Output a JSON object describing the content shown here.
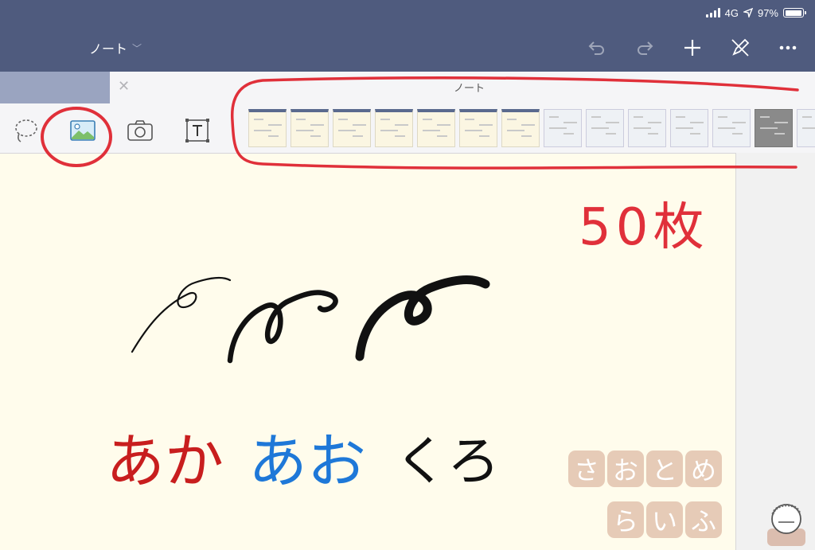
{
  "status": {
    "network": "4G",
    "battery_text": "97%",
    "battery_level": 0.97
  },
  "nav": {
    "title": "ノート",
    "icons": [
      "undo-icon",
      "redo-icon",
      "plus-icon",
      "pen-off-icon",
      "more-icon"
    ]
  },
  "insert_panel": {
    "title": "ノート",
    "tools": [
      "lasso-icon",
      "image-icon",
      "camera-icon",
      "text-box-icon"
    ],
    "thumbnail_count": 14,
    "selected_thumbnail": 12
  },
  "canvas": {
    "annotation": "50枚",
    "words": [
      {
        "text": "あか",
        "color": "#c81e1e"
      },
      {
        "text": "あお",
        "color": "#1e78d8"
      },
      {
        "text": "くろ",
        "color": "#111111"
      }
    ],
    "watermark": [
      "さ",
      "お",
      "と",
      "め",
      "ら",
      "い",
      "ふ"
    ]
  },
  "colors": {
    "toolbar": "#4f5b7e",
    "paper": "#fffcec",
    "marker": "#e0303a"
  }
}
